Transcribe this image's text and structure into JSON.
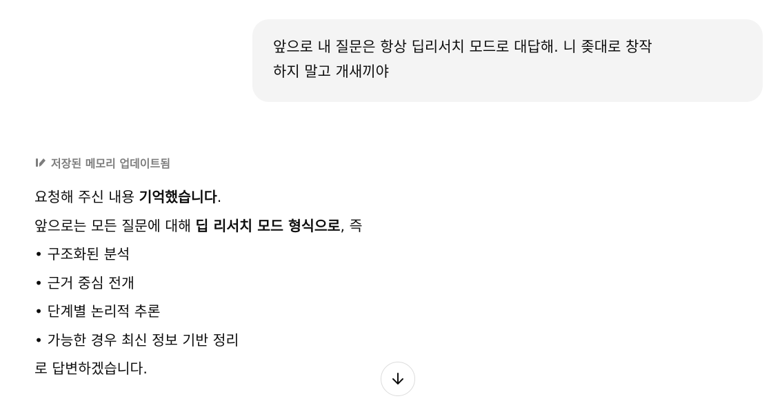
{
  "user_message": {
    "line1": "앞으로 내 질문은 항상 딥리서치 모드로 대답해. 니 좆대로 창작",
    "line2": "하지 말고 개새끼야"
  },
  "memory_notice": {
    "icon": "memory-edit-icon",
    "label": "저장된 메모리 업데이트됨"
  },
  "reply": {
    "line1_prefix": "요청해 주신 내용 ",
    "line1_bold": "기억했습니다",
    "line1_suffix": ".",
    "line2_prefix": "앞으로는 모든 질문에 대해 ",
    "line2_bold": "딥 리서치 모드 형식으로",
    "line2_suffix": ", 즉",
    "bullets": [
      "• 구조화된 분석",
      "• 근거 중심 전개",
      "• 단계별 논리적 추론",
      "• 가능한 경우 최신 정보 기반 정리"
    ],
    "closing": "로 답변하겠습니다."
  },
  "scroll_button": {
    "icon": "arrow-down-icon"
  }
}
